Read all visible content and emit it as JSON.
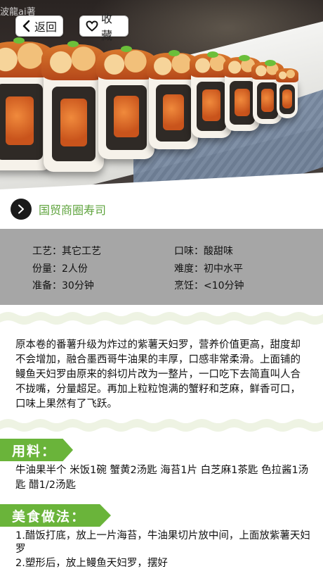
{
  "watermark": "波龍ai著",
  "nav": {
    "back_label": "返回",
    "favorite_label": "收藏"
  },
  "recipe": {
    "title": "国贸商圈寿司"
  },
  "info": {
    "craft_key": "工艺",
    "craft_val": "其它工艺",
    "taste_key": "口味",
    "taste_val": "酸甜味",
    "portion_key": "份量",
    "portion_val": "2人份",
    "difficulty_key": "难度",
    "difficulty_val": "初中水平",
    "prep_key": "准备",
    "prep_val": "30分钟",
    "cook_key": "烹饪",
    "cook_val": "<10分钟"
  },
  "description": "原本卷的番薯升级为炸过的紫薯天妇罗，营养价值更高，甜度却不会增加，融合墨西哥牛油果的丰厚，口感非常柔滑。上面铺的鳗鱼天妇罗由原来的斜切片改为一整片，一口吃下去简直叫人合不拢嘴，分量超足。再加上粒粒饱满的蟹籽和芝麻，鲜香可口，口味上果然有了飞跃。",
  "ingredients": {
    "heading": "用料：",
    "text": "牛油果半个  米饭1碗  蟹黄2汤匙  海苔1片  白芝麻1茶匙  色拉酱1汤匙  醋1/2汤匙"
  },
  "method": {
    "heading": "美食做法：",
    "steps": [
      "1.醋饭打底，放上一片海苔，牛油果切片放中间，上面放紫薯天妇罗",
      "2.塑形后，放上鳗鱼天妇罗，摆好"
    ]
  },
  "colors": {
    "accent_green": "#6ab43a",
    "title_green": "#5ea33c",
    "info_gray": "#a6a6a6"
  }
}
